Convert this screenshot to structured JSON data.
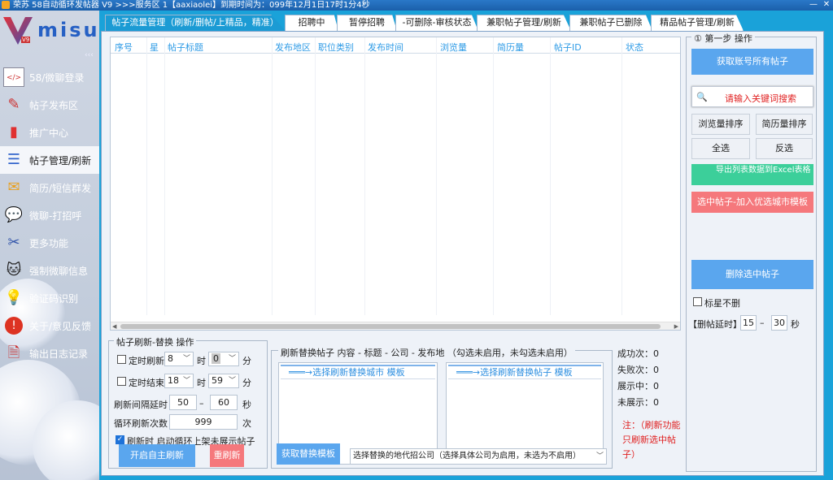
{
  "titlebar": {
    "text": "荣苏 58自动循环发帖器 V9 >>>服务区 1【aaxiaolei】到期时间为：099年12月1日17时1分4秒",
    "min": "—",
    "close": "✕"
  },
  "sidebar": {
    "logo_text": "misu",
    "logo_badge": "V9",
    "collapse": "‹‹‹",
    "items": [
      {
        "label": "58/微聊登录",
        "icon": "</>"
      },
      {
        "label": "帖子发布区",
        "icon": "✎"
      },
      {
        "label": "推广中心",
        "icon": "▮"
      },
      {
        "label": "帖子管理/刷新",
        "icon": "☰"
      },
      {
        "label": "简历/短信群发",
        "icon": "✉"
      },
      {
        "label": "微聊-打招呼",
        "icon": "💬"
      },
      {
        "label": "更多功能",
        "icon": "✂"
      },
      {
        "label": "强制微聊信息",
        "icon": "🐱"
      },
      {
        "label": "验证码识别",
        "icon": "💡"
      },
      {
        "label": "关于/意见反馈",
        "icon": "!"
      },
      {
        "label": "输出日志记录",
        "icon": "🗎"
      }
    ]
  },
  "tabs": [
    "帖子流量管理（刷新/删帖/上精品，精准）",
    "招聘中",
    "暂停招聘",
    "-可删除-审核状态",
    "兼职帖子管理/刷新",
    "兼职帖子已删除",
    "精品帖子管理/刷新"
  ],
  "table": {
    "columns": [
      "序号",
      "星",
      "帖子标题",
      "发布地区",
      "职位类别",
      "发布时间",
      "浏览量",
      "简历量",
      "帖子ID",
      "状态"
    ]
  },
  "right_panel": {
    "title": "①  第一步 操作",
    "get_all": "获取账号所有帖子",
    "search_icon": "🔍",
    "search_placeholder": "请输入关键词搜索",
    "sort_views": "浏览量排序",
    "sort_resumes": "简历量排序",
    "select_all": "全选",
    "invert": "反选",
    "export": "导出列表数据到Excel表格",
    "add_template": "选中帖子-加入优选城市模板",
    "delete": "删除选中帖子",
    "star_keep": "标星不删",
    "delay_label": "【删帖延时】",
    "delay_from": "15",
    "delay_dash": "–",
    "delay_to": "30",
    "delay_unit": "秒"
  },
  "refresh_box": {
    "title": "帖子刷新-替换 操作",
    "timed_refresh": "定时刷新",
    "start_hour": "8",
    "hour_unit": "时",
    "start_min": "0",
    "min_unit": "分",
    "timed_end": "定时结束",
    "end_hour": "18",
    "end_min": "59",
    "interval_label": "刷新间隔延时",
    "interval_from": "50",
    "interval_dash": "–",
    "interval_to": "60",
    "sec_unit": "秒",
    "loop_label": "循环刷新次数",
    "loop_count": "999",
    "times_unit": "次",
    "loop_check": "刷新时 启动循环上架未展示帖子",
    "start_btn": "开启自主刷新",
    "restart_btn": "重刷新"
  },
  "replace_box": {
    "title": "刷新替换帖子 内容 - 标题 - 公司 - 发布地 （勾选未启用，未勾选未启用）",
    "list1": "═══→选择刷新替换城市 模板",
    "list2": "═══→选择刷新替换帖子 模板",
    "get_template": "获取替换模板",
    "company_select": "选择替换的地代招公司（选择具体公司为启用，未选为不启用）",
    "dd": "﹀"
  },
  "stats": [
    {
      "label": "成功次",
      "value": "0"
    },
    {
      "label": "失败次",
      "value": "0"
    },
    {
      "label": "展示中",
      "value": "0"
    },
    {
      "label": "未展示",
      "value": "0"
    }
  ],
  "note": "注：（刷新功能只刷新选中帖子）"
}
